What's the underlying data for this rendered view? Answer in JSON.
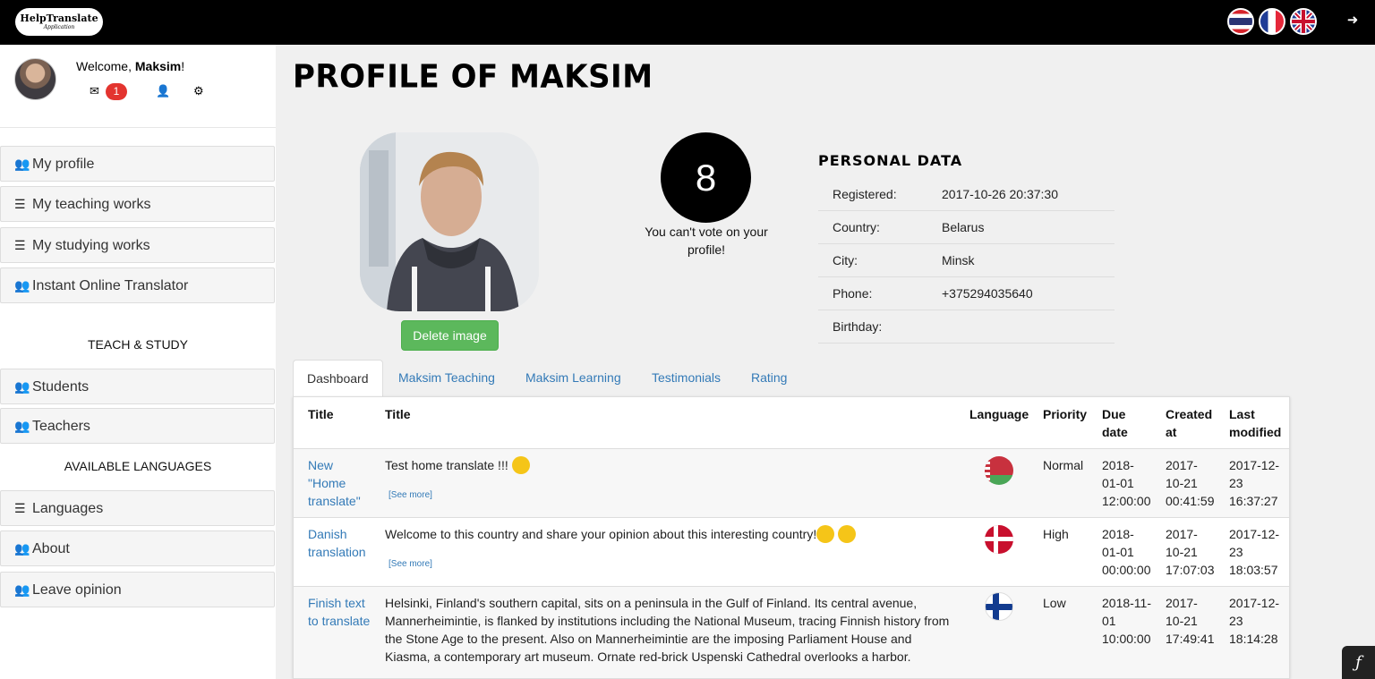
{
  "header": {
    "logo_line1": "HelpTranslate",
    "logo_line2": "Application",
    "flags": [
      "thai-flag-icon",
      "french-flag-icon",
      "uk-flag-icon"
    ],
    "logout_icon": "sign-out-icon"
  },
  "sidebar": {
    "welcome_prefix": "Welcome, ",
    "user_name": "Maksim",
    "welcome_suffix": "!",
    "messages_badge": "1",
    "items": [
      {
        "label": "My profile",
        "icon": "users-icon"
      },
      {
        "label": "My teaching works",
        "icon": "list-icon"
      },
      {
        "label": "My studying works",
        "icon": "list-icon"
      },
      {
        "label": "Instant Online Translator",
        "icon": "users-icon"
      }
    ],
    "teach_heading": "TEACH & STUDY",
    "teach_items": [
      {
        "label": "Students",
        "icon": "users-icon"
      },
      {
        "label": "Teachers",
        "icon": "users-icon"
      }
    ],
    "languages_heading": "AVAILABLE LANGUAGES",
    "lang_items": [
      {
        "label": "Languages",
        "icon": "list-icon"
      },
      {
        "label": "About",
        "icon": "users-icon"
      },
      {
        "label": "Leave opinion",
        "icon": "users-icon"
      }
    ]
  },
  "profile": {
    "title": "Profile of Maksim",
    "delete_image": "Delete image",
    "vote_count": "8",
    "vote_note": "You can't vote on your profile!",
    "personal_data_title": "Personal data",
    "personal_data": [
      {
        "key": "Registered:",
        "value": "2017-10-26 20:37:30"
      },
      {
        "key": "Country:",
        "value": "Belarus"
      },
      {
        "key": "City:",
        "value": "Minsk"
      },
      {
        "key": "Phone:",
        "value": "+375294035640"
      },
      {
        "key": "Birthday:",
        "value": ""
      }
    ]
  },
  "tabs": [
    "Dashboard",
    "Maksim Teaching",
    "Maksim Learning",
    "Testimonials",
    "Rating"
  ],
  "table": {
    "headers": {
      "title1": "Title",
      "title2": "Title",
      "language": "Language",
      "priority": "Priority",
      "due_1": "Due",
      "due_2": "date",
      "created_1": "Created",
      "created_2": "at",
      "modified_1": "Last",
      "modified_2": "modified"
    },
    "see_more": "[See more]",
    "rows": [
      {
        "name_lines": [
          "New",
          "\"Home",
          "translate\""
        ],
        "text": "Test home translate !!!",
        "language": "Belarus",
        "priority": "Normal",
        "due": [
          "2018-",
          "01-01",
          "12:00:00"
        ],
        "created": [
          "2017-",
          "10-21",
          "00:41:59"
        ],
        "modified": [
          "2017-12-",
          "23",
          "16:37:27"
        ]
      },
      {
        "name_lines": [
          "Danish",
          "translation"
        ],
        "text": "Welcome to this country and share your opinion about this interesting country!",
        "language": "Denmark",
        "priority": "High",
        "due": [
          "2018-",
          "01-01",
          "00:00:00"
        ],
        "created": [
          "2017-",
          "10-21",
          "17:07:03"
        ],
        "modified": [
          "2017-12-",
          "23",
          "18:03:57"
        ]
      },
      {
        "name_lines": [
          "Finish text",
          "to translate"
        ],
        "text_lines": [
          "Helsinki, Finland's southern capital, sits on a peninsula in the Gulf of Finland. Its central avenue,",
          "Mannerheimintie, is flanked by institutions including the National Museum, tracing Finnish history from",
          "the Stone Age to the present. Also on Mannerheimintie are the imposing Parliament House and",
          "Kiasma, a contemporary art museum. Ornate red-brick Uspenski Cathedral overlooks a harbor."
        ],
        "language": "Finland",
        "priority": "Low",
        "due": [
          "2018-11-",
          "01",
          "10:00:00"
        ],
        "created": [
          "2017-",
          "10-21",
          "17:49:41"
        ],
        "modified": [
          "2017-12-",
          "23",
          "18:14:28"
        ]
      }
    ]
  }
}
